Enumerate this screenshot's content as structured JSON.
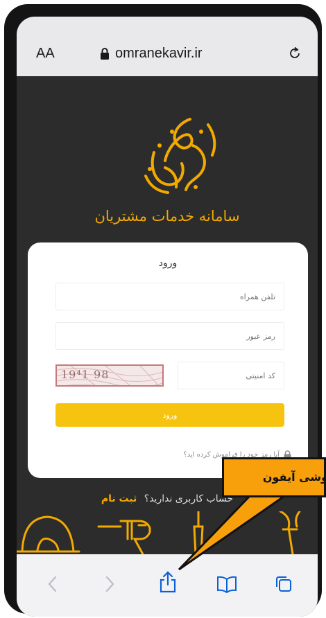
{
  "browser": {
    "aa_label": "AA",
    "url": "omranekavir.ir"
  },
  "page": {
    "portal_title": "سامانه خدمات مشتریان",
    "login": {
      "title": "ورود",
      "phone_placeholder": "تلفن همراه",
      "password_placeholder": "رمز عبور",
      "captcha_placeholder": "کد امنیتی",
      "captcha_value": "19⁴1 98",
      "submit_label": "ورود",
      "forgot_text": "آیا رمز خود را فراموش کرده اید؟"
    },
    "signup": {
      "question": "حساب کاربری ندارید؟",
      "link": "ثبت نام"
    }
  },
  "callout": {
    "text": "وشی آیفون"
  },
  "colors": {
    "brand_gold": "#f2a900",
    "button_yellow": "#f6c40e",
    "callout_orange": "#f7a00c",
    "page_dark": "#2c2c2c"
  },
  "icons": {
    "logo": "omran-kavir-calligraphy-logo",
    "tools": [
      "hard-hat-icon",
      "drill-icon",
      "screwdriver-icon",
      "wrench-icon"
    ],
    "toolbar": [
      "back-icon",
      "forward-icon",
      "share-icon",
      "bookmarks-icon",
      "tabs-icon"
    ]
  }
}
